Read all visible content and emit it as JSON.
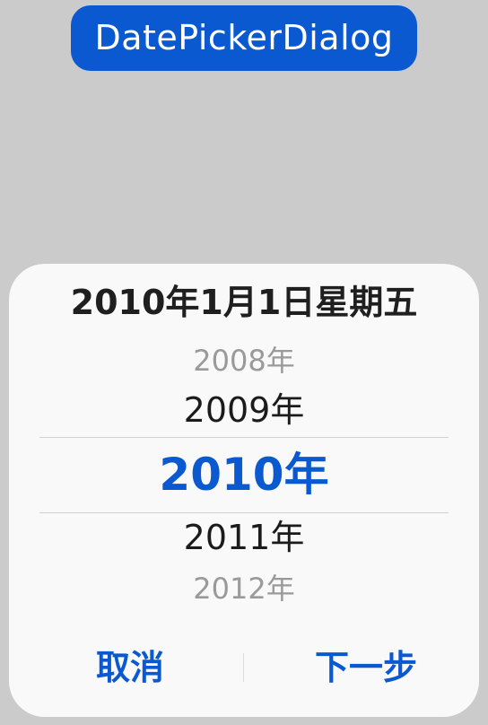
{
  "trigger_button": {
    "label": "DatePickerDialog"
  },
  "dialog": {
    "title": "2010年1月1日星期五",
    "year_wheel": {
      "items": [
        "2008年",
        "2009年",
        "2010年",
        "2011年",
        "2012年"
      ],
      "selected": "2010年"
    },
    "buttons": {
      "cancel": "取消",
      "next": "下一步"
    }
  },
  "colors": {
    "accent": "#0a59d1",
    "background": "#cbcbcb",
    "dialog_background": "#f9f9f9"
  }
}
